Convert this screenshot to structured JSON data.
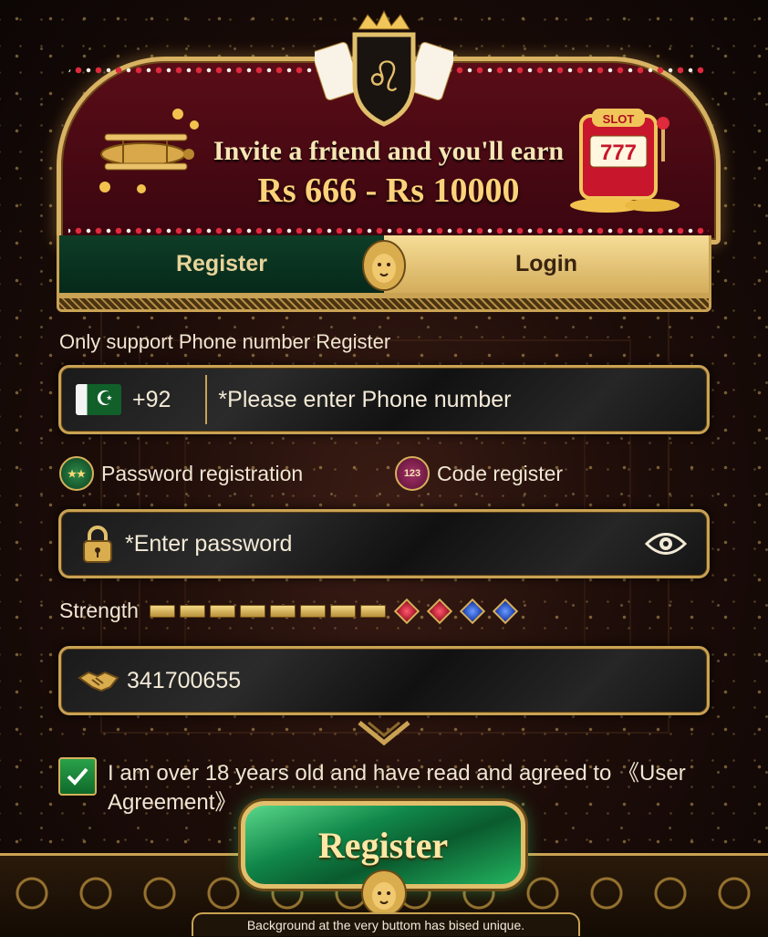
{
  "banner": {
    "line1": "Invite a friend and you'll earn",
    "line2": "Rs 666 - Rs 10000"
  },
  "tabs": {
    "register": "Register",
    "login": "Login",
    "active": "Register"
  },
  "support_text": "Only support Phone number Register",
  "phone": {
    "country_code": "+92",
    "placeholder": "*Please enter Phone number"
  },
  "modes": {
    "password": "Password registration",
    "code": "Code register",
    "code_badge": "123"
  },
  "password": {
    "placeholder": "*Enter password"
  },
  "strength": {
    "label": "Strength",
    "gold_bars": 8,
    "gems": [
      "red",
      "red",
      "blue",
      "blue"
    ]
  },
  "invite": {
    "code": "341700655"
  },
  "agreement": {
    "checked": true,
    "text": "I am over 18 years old and have read and agreed to 《User Agreement》"
  },
  "register_button": "Register",
  "footer_note": "Background at the very buttom has bised unique.",
  "colors": {
    "gold": "#c9a253",
    "maroon": "#5a0d17",
    "green": "#0e3d27"
  }
}
